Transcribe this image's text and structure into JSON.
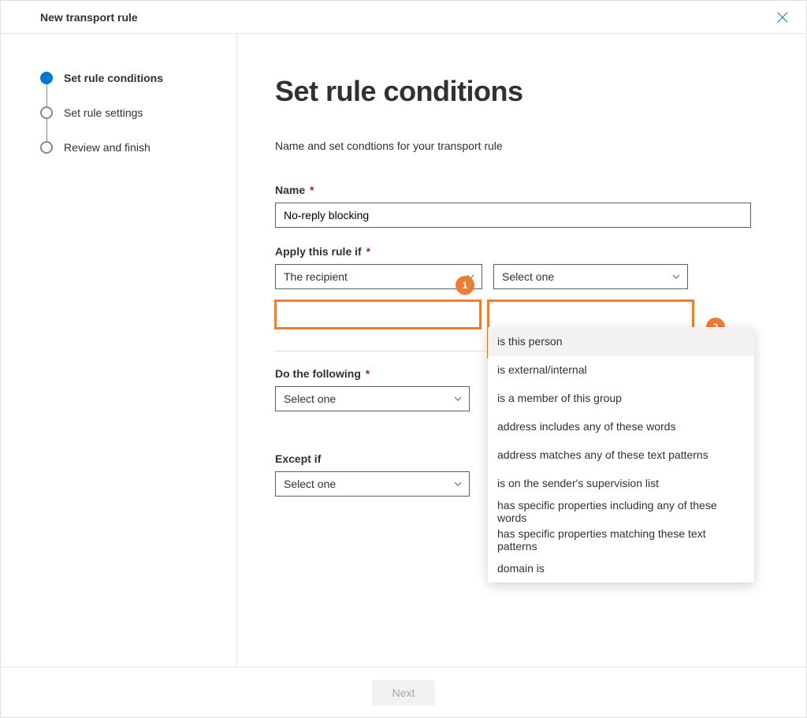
{
  "header": {
    "title": "New transport rule"
  },
  "steps": [
    {
      "label": "Set rule conditions"
    },
    {
      "label": "Set rule settings"
    },
    {
      "label": "Review and finish"
    }
  ],
  "main": {
    "heading": "Set rule conditions",
    "subtitle": "Name and set condtions for your transport rule",
    "name_label": "Name",
    "name_value": "No-reply blocking",
    "apply_label": "Apply this rule if",
    "apply_select1": "The recipient",
    "apply_select2": "Select one",
    "do_label": "Do the following",
    "do_select": "Select one",
    "except_label": "Except if",
    "except_select": "Select one"
  },
  "dropdown": {
    "options": [
      "is this person",
      "is external/internal",
      "is a member of this group",
      "address includes any of these words",
      "address matches any of these text patterns",
      "is on the sender's supervision list",
      "has specific properties including any of these words",
      "has specific properties matching these text patterns",
      "domain is"
    ]
  },
  "annot": {
    "b1": "1",
    "b2": "2"
  },
  "footer": {
    "next": "Next"
  }
}
